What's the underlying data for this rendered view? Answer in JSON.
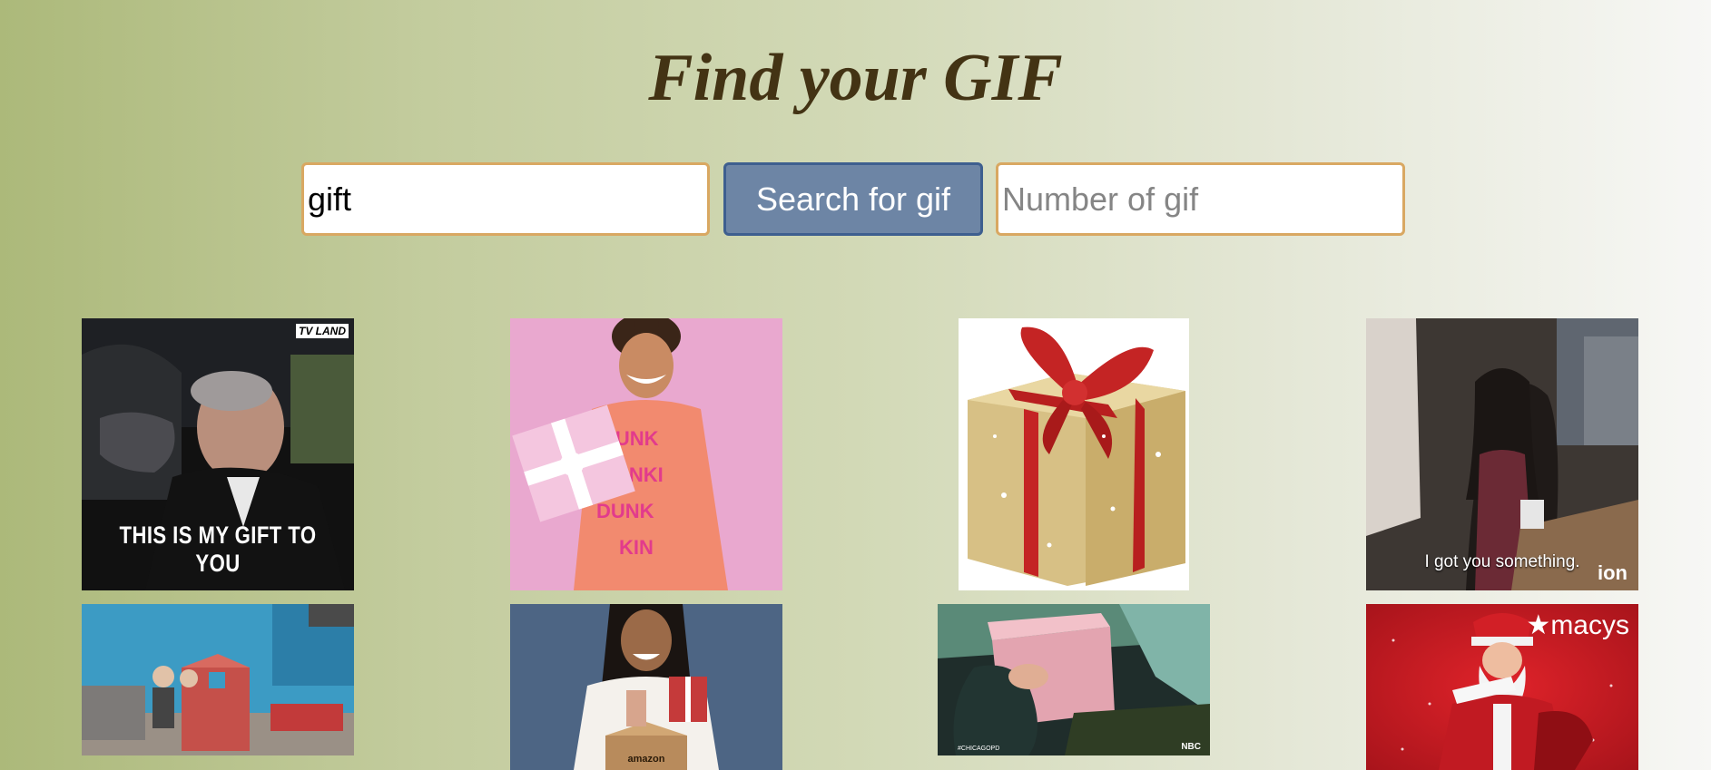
{
  "header": {
    "title": "Find your GIF"
  },
  "search": {
    "value": "gift",
    "button_label": "Search for gif",
    "count_placeholder": "Number of gif"
  },
  "gifs": [
    {
      "caption": "THIS IS MY GIFT TO YOU",
      "tag": "TV LAND"
    },
    {
      "caption": "",
      "tag": ""
    },
    {
      "caption": "",
      "tag": ""
    },
    {
      "caption": "I got you something.",
      "tag": "ion"
    },
    {
      "caption": "",
      "tag": ""
    },
    {
      "caption": "",
      "tag": "amazon"
    },
    {
      "caption": "",
      "tag": "NBC",
      "tag2": "#CHICAGOPD"
    },
    {
      "caption": "",
      "tag": "★macys"
    }
  ],
  "colors": {
    "title": "#433314",
    "input_border": "#d9a862",
    "button_bg": "#6d85a5",
    "button_border": "#3e5f8f"
  }
}
